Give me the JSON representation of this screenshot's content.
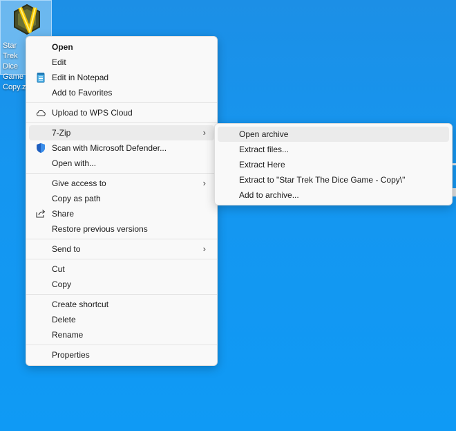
{
  "desktop": {
    "icon_label": "Star Trek\nDice Game\nCopy.zip"
  },
  "context_menu": {
    "open": "Open",
    "edit": "Edit",
    "edit_notepad": "Edit in Notepad",
    "add_favorites": "Add to Favorites",
    "upload_wps": "Upload to WPS Cloud",
    "seven_zip": "7-Zip",
    "scan_defender": "Scan with Microsoft Defender...",
    "open_with": "Open with...",
    "give_access": "Give access to",
    "copy_path": "Copy as path",
    "share": "Share",
    "restore_versions": "Restore previous versions",
    "send_to": "Send to",
    "cut": "Cut",
    "copy": "Copy",
    "create_shortcut": "Create shortcut",
    "delete": "Delete",
    "rename": "Rename",
    "properties": "Properties"
  },
  "submenu_7zip": {
    "open_archive": "Open archive",
    "extract_files": "Extract files...",
    "extract_here": "Extract Here",
    "extract_to": "Extract to \"Star Trek The Dice Game - Copy\\\"",
    "add_archive": "Add to archive..."
  },
  "icons": {
    "desktop_file": "zip-archive-icon",
    "notepad": "notepad-icon",
    "cloud": "cloud-icon",
    "defender": "shield-icon",
    "share": "share-icon",
    "submenu": "chevron-right-icon"
  },
  "colors": {
    "desktop_bg": "#1596f0",
    "menu_bg": "#f9f9f9",
    "hover_bg": "#ebebeb",
    "defender_blue": "#1f5fbf"
  }
}
